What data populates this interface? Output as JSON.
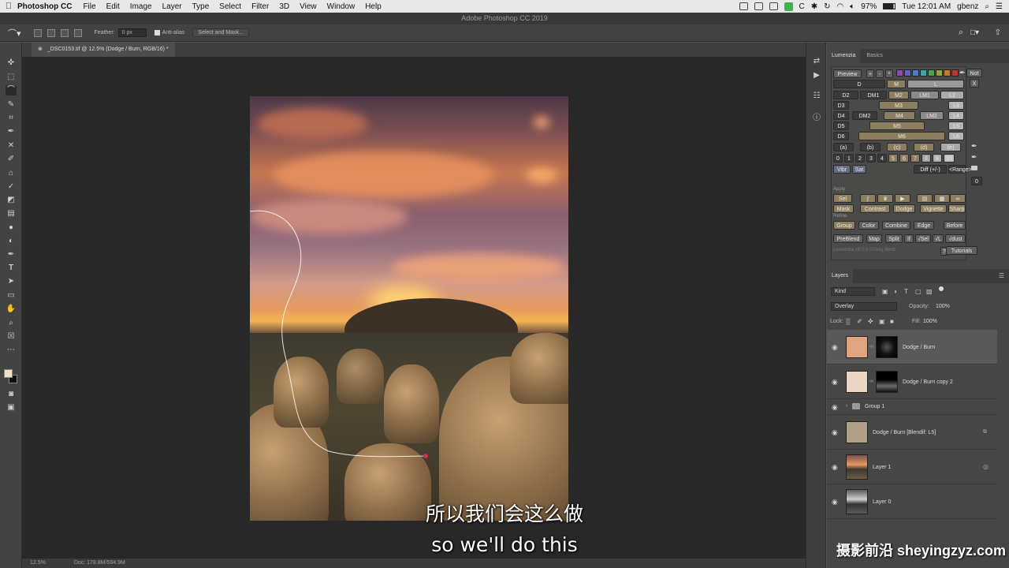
{
  "menubar": {
    "app_name": "Photoshop CC",
    "items": [
      "File",
      "Edit",
      "Image",
      "Layer",
      "Type",
      "Select",
      "Filter",
      "3D",
      "View",
      "Window",
      "Help"
    ],
    "battery": "97%",
    "clock": "Tue 12:01 AM",
    "user": "gbenz"
  },
  "window_title": "Adobe Photoshop CC 2019",
  "options": {
    "feather_label": "Feather:",
    "feather_value": "0 px",
    "antialias_label": "Anti-alias",
    "select_mask_label": "Select and Mask..."
  },
  "document_tab": "_DSC0153.tif @ 12.5% (Dodge / Burn, RGB/16) *",
  "status": {
    "zoom": "12.5%",
    "doc": "Doc: 178.8M/594.9M"
  },
  "subtitles": {
    "zh": "所以我们会这么做",
    "en": "so we'll do this"
  },
  "watermark": "摄影前沿 sheyingzyz.com",
  "lumenzia": {
    "tabs": [
      "Lumenzia",
      "Basics"
    ],
    "preview_label": "Preview",
    "not_label": "Not",
    "x_label": "X",
    "rows": {
      "r1": [
        "D",
        "M",
        "L"
      ],
      "r2": [
        "D2",
        "DM1",
        "M2",
        "LM1",
        "L2"
      ],
      "r3": [
        "D3",
        "M3",
        "L3"
      ],
      "r4": [
        "D4",
        "DM2",
        "M4",
        "LM2",
        "L4"
      ],
      "r5": [
        "D5",
        "M5",
        "L5"
      ],
      "r6": [
        "D6",
        "M6",
        "L6"
      ]
    },
    "letters": [
      "(a)",
      "(b)",
      "(c)",
      "(d)",
      "(e)"
    ],
    "numbers": [
      "0",
      "1",
      "2",
      "3",
      "4",
      "5",
      "6",
      "7",
      "8",
      "9",
      "10"
    ],
    "vibr": "Vibr",
    "sat": "Sat",
    "diff": "Diff (+/-)",
    "range": "<Range>",
    "apply_label": "Apply",
    "apply_row": [
      "Sel",
      "Mask",
      "Contrast",
      "Dodge",
      "Vignette",
      "Sharp"
    ],
    "refine_label": "Refine",
    "refine_row": [
      "Group",
      "Color",
      "Combine",
      "Edge",
      "Before"
    ],
    "bottom_row": [
      "PreBlend",
      "Map",
      "Split",
      "If",
      "√Sel",
      "√L",
      "√dust"
    ],
    "version": "Lumenzia v8.0.0 ©Greg Benz",
    "help": "?",
    "tutorials": "Tutorials",
    "zero": "0"
  },
  "layers": {
    "title": "Layers",
    "kind": "Kind",
    "blend_mode": "Overlay",
    "opacity_label": "Opacity:",
    "opacity_value": "100%",
    "lock_label": "Lock:",
    "fill_label": "Fill:",
    "fill_value": "100%",
    "items": [
      {
        "name": "Dodge / Burn",
        "color": "#e0a480"
      },
      {
        "name": "Dodge / Burn copy 2",
        "color": "#ead6c4"
      },
      {
        "name": "Group 1"
      },
      {
        "name": "Dodge / Burn [Blendif: L5]",
        "color": "#b0a088"
      },
      {
        "name": "Layer 1"
      },
      {
        "name": "Layer 0"
      }
    ]
  }
}
